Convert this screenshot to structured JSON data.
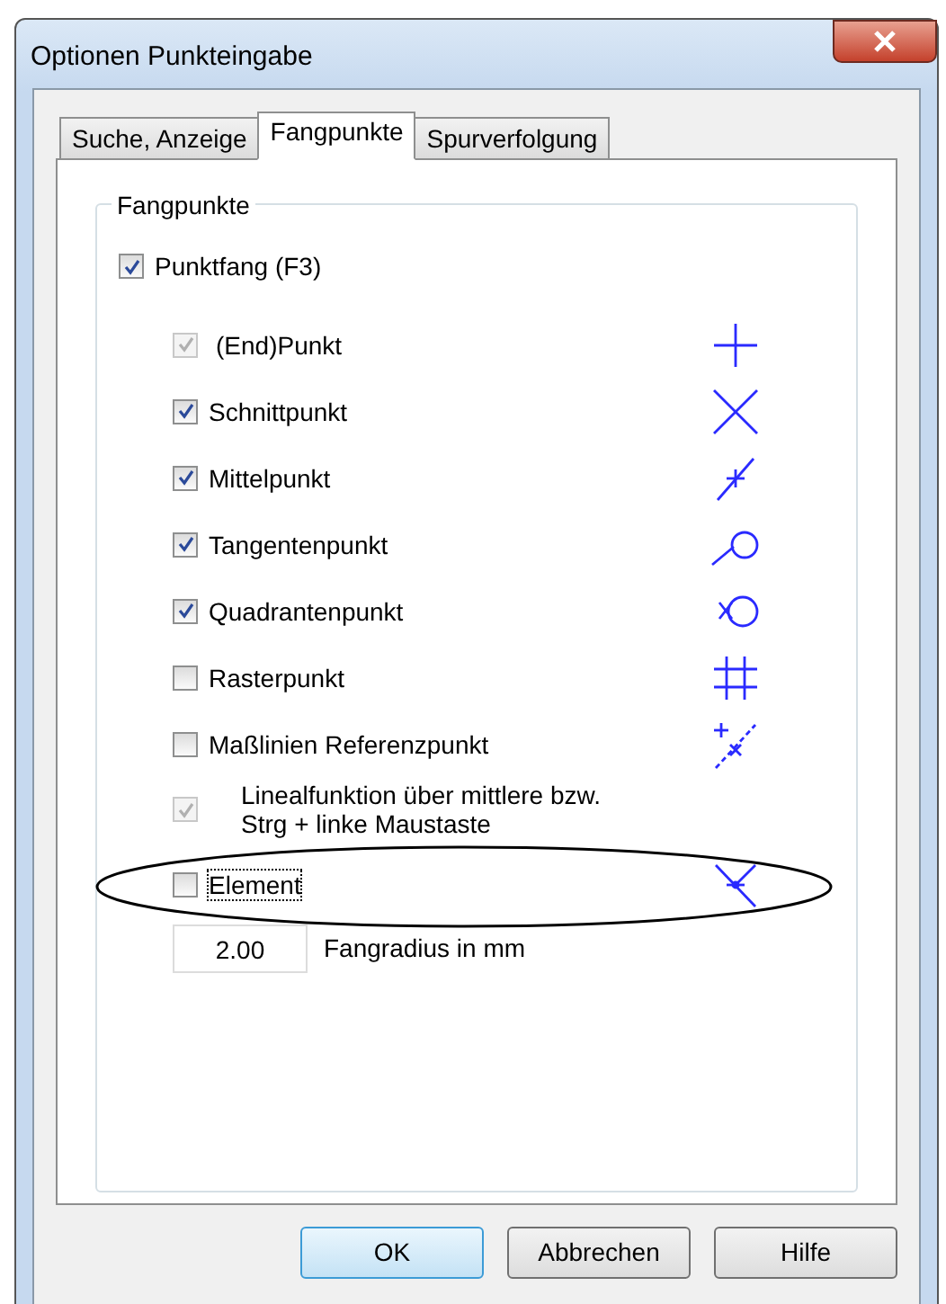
{
  "window": {
    "title": "Optionen Punkteingabe"
  },
  "tabs": [
    {
      "label": "Suche, Anzeige",
      "selected": false
    },
    {
      "label": "Fangpunkte",
      "selected": true
    },
    {
      "label": "Spurverfolgung",
      "selected": false
    }
  ],
  "group": {
    "title": "Fangpunkte",
    "master": {
      "label": "Punktfang (F3)",
      "checked": true
    },
    "items": [
      {
        "label": "(End)Punkt",
        "checked": true,
        "disabled": true,
        "focused": false
      },
      {
        "label": "Schnittpunkt",
        "checked": true,
        "disabled": false,
        "focused": false
      },
      {
        "label": "Mittelpunkt",
        "checked": true,
        "disabled": false,
        "focused": false
      },
      {
        "label": "Tangentenpunkt",
        "checked": true,
        "disabled": false,
        "focused": false
      },
      {
        "label": "Quadrantenpunkt",
        "checked": true,
        "disabled": false,
        "focused": false
      },
      {
        "label": "Rasterpunkt",
        "checked": false,
        "disabled": false,
        "focused": false
      },
      {
        "label": "Maßlinien Referenzpunkt",
        "checked": false,
        "disabled": false,
        "focused": false
      },
      {
        "label": "Linealfunktion über mittlere bzw. Strg + linke Maustaste",
        "checked": true,
        "disabled": true,
        "focused": false
      },
      {
        "label": "Element",
        "checked": false,
        "disabled": false,
        "focused": true
      }
    ],
    "radius": {
      "value": "2.00",
      "label": "Fangradius in mm"
    }
  },
  "buttons": [
    {
      "label": "OK",
      "default": true
    },
    {
      "label": "Abbrechen",
      "default": false
    },
    {
      "label": "Hilfe",
      "default": false
    }
  ]
}
